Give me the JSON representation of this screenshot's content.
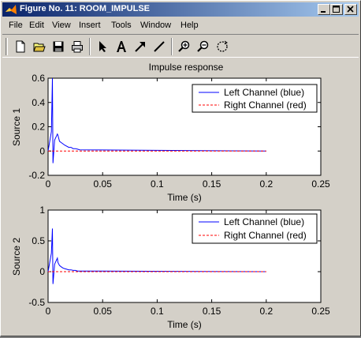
{
  "window": {
    "title": "Figure No. 11: ROOM_IMPULSE"
  },
  "menu": [
    "File",
    "Edit",
    "View",
    "Insert",
    "Tools",
    "Window",
    "Help"
  ],
  "toolbar": {
    "tools": [
      "new-figure-icon",
      "open-file-icon",
      "save-icon",
      "print-icon",
      "select-arrow-icon",
      "insert-text-icon",
      "insert-arrow-icon",
      "insert-line-icon",
      "zoom-in-icon",
      "zoom-out-icon",
      "rotate-3d-icon"
    ]
  },
  "figure_title": "Impulse response",
  "colors": {
    "left": "#0000ff",
    "right": "#ff0000",
    "titlebar_start": "#0a246a",
    "titlebar_end": "#a6caf0",
    "window_bg": "#d4d0c8"
  },
  "chart_data": [
    {
      "type": "line",
      "title": "Impulse response",
      "xlabel": "Time (s)",
      "ylabel": "Source 1",
      "xlim": [
        0,
        0.25
      ],
      "ylim": [
        -0.2,
        0.6
      ],
      "xticks": [
        "0",
        "0.05",
        "0.1",
        "0.15",
        "0.2",
        "0.25"
      ],
      "yticks": [
        "-0.2",
        "0",
        "0.2",
        "0.4",
        "0.6"
      ],
      "legend_position": "top-right",
      "series": [
        {
          "name": "Left Channel (blue)",
          "style": "solid",
          "color": "#0000ff",
          "x": [
            0,
            0.003,
            0.004,
            0.0045,
            0.006,
            0.0085,
            0.009,
            0.0105,
            0.012,
            0.0135,
            0.015,
            0.017,
            0.019,
            0.021,
            0.023,
            0.025,
            0.027,
            0.029,
            0.2
          ],
          "y": [
            0,
            0.16,
            0.6,
            -0.1,
            0.09,
            0.14,
            0.13,
            0.08,
            0.07,
            0.06,
            0.05,
            0.04,
            0.03,
            0.03,
            0.02,
            0.02,
            0.015,
            0.01,
            0
          ]
        },
        {
          "name": "Right Channel (red)",
          "style": "dashed",
          "color": "#ff0000",
          "x": [
            0,
            0.2
          ],
          "y": [
            0,
            0
          ]
        }
      ]
    },
    {
      "type": "line",
      "title": "",
      "xlabel": "Time (s)",
      "ylabel": "Source 2",
      "xlim": [
        0,
        0.25
      ],
      "ylim": [
        -0.5,
        1
      ],
      "xticks": [
        "0",
        "0.05",
        "0.1",
        "0.15",
        "0.2",
        "0.25"
      ],
      "yticks": [
        "-0.5",
        "0",
        "0.5",
        "1"
      ],
      "legend_position": "top-right",
      "series": [
        {
          "name": "Left Channel (blue)",
          "style": "solid",
          "color": "#0000ff",
          "x": [
            0,
            0.003,
            0.004,
            0.0045,
            0.006,
            0.0085,
            0.009,
            0.0105,
            0.012,
            0.0135,
            0.015,
            0.017,
            0.019,
            0.021,
            0.023,
            0.025,
            0.027,
            0.2
          ],
          "y": [
            0,
            0.3,
            0.7,
            -0.2,
            0.12,
            0.22,
            0.15,
            0.1,
            0.08,
            0.06,
            0.05,
            0.04,
            0.03,
            0.03,
            0.02,
            0.02,
            0.01,
            0
          ]
        },
        {
          "name": "Right Channel (red)",
          "style": "dashed",
          "color": "#ff0000",
          "x": [
            0,
            0.2
          ],
          "y": [
            0,
            0
          ]
        }
      ]
    }
  ]
}
